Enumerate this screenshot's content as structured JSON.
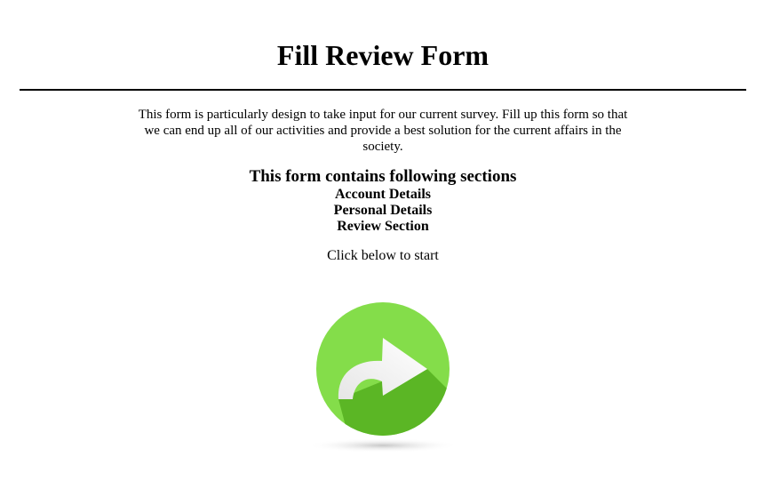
{
  "page": {
    "title": "Fill Review Form",
    "intro": "This form is particularly design to take input for our current survey. Fill up this form so that we can end up all of our activities and provide a best solution for the current affairs in the society.",
    "sections_heading": "This form contains following sections",
    "sections": [
      "Account Details",
      "Personal Details",
      "Review Section"
    ],
    "start_hint": "Click below to start"
  },
  "start_button": {
    "icon": "forward-arrow-icon",
    "colors": {
      "circle_light": "#84dd4a",
      "circle_dark": "#5bb625",
      "arrow": "#f2f2f2"
    }
  }
}
